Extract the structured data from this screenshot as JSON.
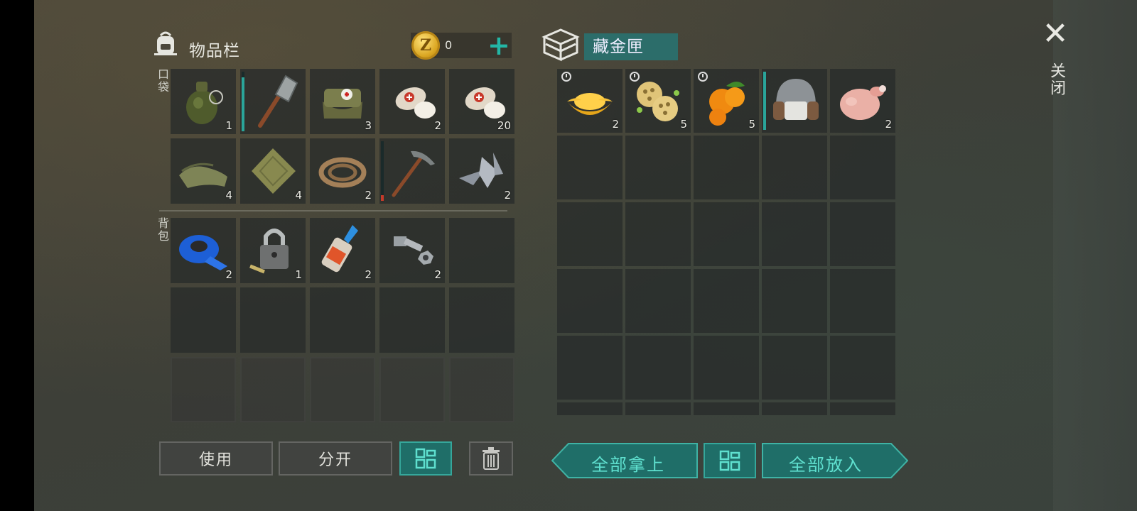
{
  "inventory": {
    "title": "物品栏",
    "coins": "0",
    "coin_symbol": "Z",
    "add_symbol": "+",
    "pocket_label": "口袋",
    "backpack_label": "背包",
    "pocket_items": [
      {
        "name": "grenade",
        "count": "1"
      },
      {
        "name": "shovel",
        "count": "",
        "durability": 0.9
      },
      {
        "name": "medkit-bag",
        "count": "3"
      },
      {
        "name": "bandage",
        "count": "2"
      },
      {
        "name": "bandage",
        "count": "20"
      },
      {
        "name": "cloth",
        "count": "4"
      },
      {
        "name": "burlap",
        "count": "4"
      },
      {
        "name": "rope",
        "count": "2"
      },
      {
        "name": "pickaxe",
        "count": "",
        "durability": 0.1
      },
      {
        "name": "scrap-metal",
        "count": "2"
      }
    ],
    "backpack_items": [
      {
        "name": "duct-tape",
        "count": "2"
      },
      {
        "name": "padlock",
        "count": "1"
      },
      {
        "name": "glue",
        "count": "2"
      },
      {
        "name": "bolt-nut",
        "count": "2"
      }
    ]
  },
  "chest": {
    "title": "藏金匣",
    "items": [
      {
        "name": "gold-ingot",
        "count": "2",
        "timer": true
      },
      {
        "name": "lotus-root",
        "count": "5",
        "timer": true
      },
      {
        "name": "kumquat",
        "count": "5",
        "timer": true
      },
      {
        "name": "fur-hat",
        "count": "",
        "durability": 1.0
      },
      {
        "name": "raw-chicken",
        "count": "2"
      }
    ]
  },
  "buttons": {
    "use": "使用",
    "split": "分开",
    "take_all": "全部拿上",
    "put_all": "全部放入"
  },
  "close": {
    "label": "关闭",
    "symbol": "✕"
  },
  "colors": {
    "accent": "#1f6e68",
    "accent_bright": "#23b7a6"
  }
}
